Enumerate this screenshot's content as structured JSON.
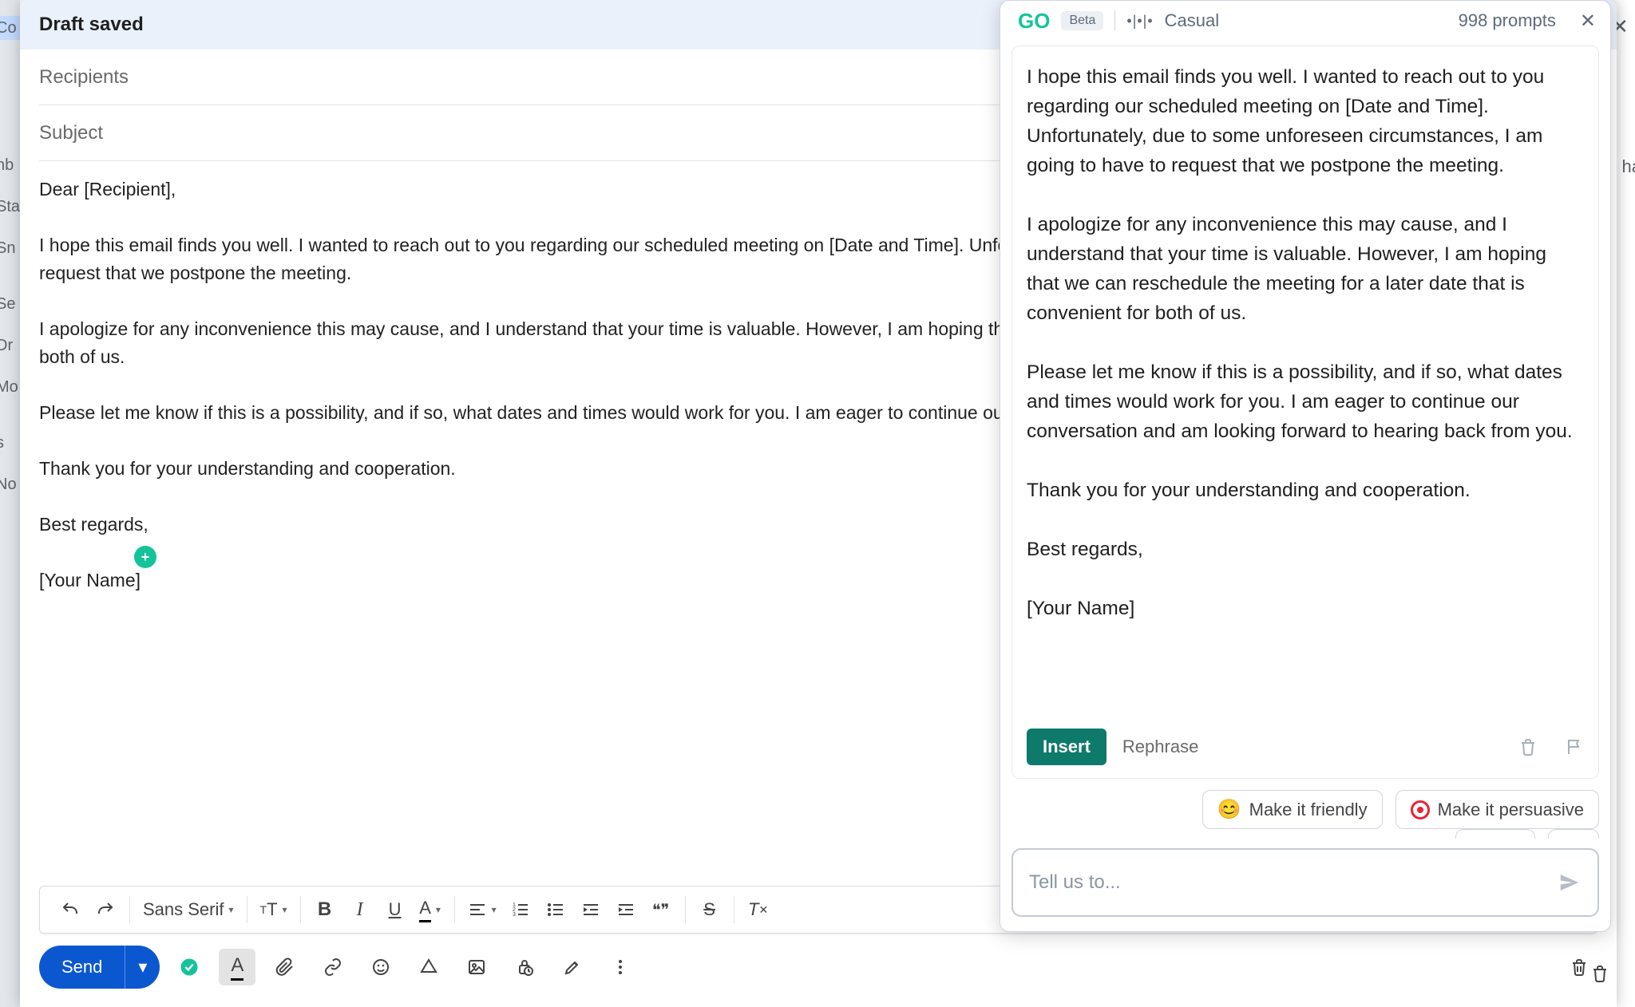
{
  "background": {
    "labels_partial": [
      "Co",
      "nb",
      "Sta",
      "Sn",
      "Se",
      "Dr",
      "Mo",
      "s",
      "No"
    ],
    "right_word": "ha"
  },
  "compose": {
    "title": "Draft saved",
    "recipients_placeholder": "Recipients",
    "subject_placeholder": "Subject",
    "body": {
      "p1": "Dear [Recipient],",
      "p2": "I hope this email finds you well. I wanted to reach out to you regarding our scheduled meeting on [Date and Time]. Unfortunately, due to some unforeseen circumstances, I am going to have to request that we postpone the meeting.",
      "p3": "I apologize for any inconvenience this may cause, and I understand that your time is valuable. However, I am hoping that we can reschedule the meeting for a later date that is convenient for both of us.",
      "p4": "Please let me know if this is a possibility, and if so, what dates and times would work for you. I am eager to continue our conversation and am looking forward to hearing back from you.",
      "p5": "Thank you for your understanding and cooperation.",
      "p6": "Best regards,",
      "p7": "[Your Name]"
    },
    "toolbar": {
      "font_name": "Sans Serif",
      "bold": "B",
      "italic": "I",
      "underline": "U",
      "color_sample": "A",
      "size_sample": "тT",
      "quote": "❝❞"
    },
    "actions": {
      "send_label": "Send"
    }
  },
  "go": {
    "logo": "GO",
    "beta": "Beta",
    "tone": "Casual",
    "prompts": "998 prompts",
    "body": {
      "p1": "I hope this email finds you well. I wanted to reach out to you regarding our scheduled meeting on [Date and Time]. Unfortunately, due to some unforeseen circumstances, I am going to have to request that we postpone the meeting.",
      "p2": "I apologize for any inconvenience this may cause, and I understand that your time is valuable. However, I am hoping that we can reschedule the meeting for a later date that is convenient for both of us.",
      "p3": "Please let me know if this is a possibility, and if so, what dates and times would work for you. I am eager to continue our conversation and am looking forward to hearing back from you.",
      "p4": "Thank you for your understanding and cooperation.",
      "p5": "Best regards,",
      "p6": "[Your Name]"
    },
    "insert": "Insert",
    "rephrase": "Rephrase",
    "chip_friendly": "Make it friendly",
    "chip_persuasive": "Make it persuasive",
    "input_placeholder": "Tell us to..."
  }
}
